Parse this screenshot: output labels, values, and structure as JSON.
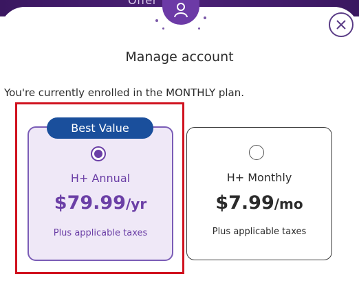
{
  "banner": {
    "text": "Offer"
  },
  "modal": {
    "title": "Manage account",
    "enrolled_text": "You're currently enrolled in the MONTHLY plan."
  },
  "plans": [
    {
      "badge": "Best Value",
      "name": "H+ Annual",
      "price": "$79.99",
      "unit": "/yr",
      "taxes": "Plus applicable taxes",
      "selected": true
    },
    {
      "name": "H+ Monthly",
      "price": "$7.99",
      "unit": "/mo",
      "taxes": "Plus applicable taxes",
      "selected": false
    }
  ],
  "icons": {
    "close": "close-icon",
    "avatar": "user-icon"
  },
  "colors": {
    "accent": "#6b3fa6",
    "badge": "#1a4f9c",
    "highlight": "#d0121f"
  }
}
